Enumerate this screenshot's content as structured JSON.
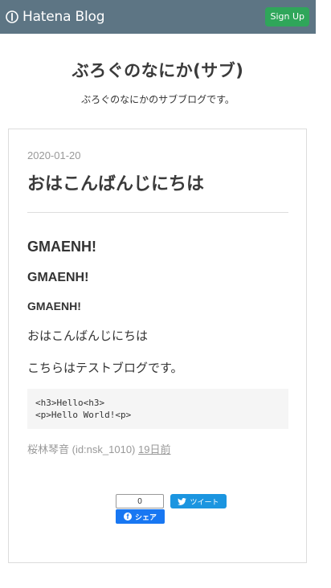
{
  "topbar": {
    "brand_text": "Hatena Blog",
    "brand_icon": "hatena-blog-icon",
    "signup_label": "Sign Up",
    "color": "#5d7584",
    "signup_color": "#2fa65a"
  },
  "blog": {
    "title": "ぶろぐのなにか(サブ)",
    "description": "ぶろぐのなにかのサブブログです。"
  },
  "entry": {
    "date": "2020-01-20",
    "title": "おはこんばんじにちは",
    "h2": "GMAENH!",
    "h3": "GMAENH!",
    "h4": "GMAENH!",
    "paragraph1": "おはこんばんじにちは",
    "paragraph2": "こちらはテストブログです。",
    "code": "<h3>Hello<h3>\n<p>Hello World!<p>",
    "author": "桜林琴音 (id:nsk_1010)",
    "posted_ago": "19日前"
  },
  "share": {
    "facebook_count": "0",
    "facebook_label": "シェア",
    "tweet_label": "ツイート",
    "facebook_color": "#1877f2",
    "twitter_color": "#1b95e0"
  }
}
